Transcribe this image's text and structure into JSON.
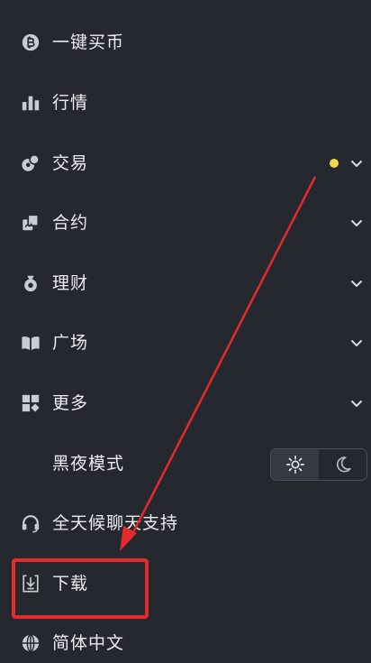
{
  "menu": {
    "buy_crypto": {
      "label": "一键买币",
      "icon": "bitcoin-icon"
    },
    "markets": {
      "label": "行情",
      "icon": "bar-chart-icon"
    },
    "trade": {
      "label": "交易",
      "icon": "trade-coins-icon",
      "has_notification": true,
      "notification_color": "#f0d84a"
    },
    "futures": {
      "label": "合约",
      "icon": "futures-icon"
    },
    "finance": {
      "label": "理财",
      "icon": "money-bag-icon"
    },
    "square": {
      "label": "广场",
      "icon": "book-icon"
    },
    "more": {
      "label": "更多",
      "icon": "grid-icon"
    },
    "dark_mode": {
      "label": "黑夜模式",
      "selected": "light",
      "options": [
        "sun-icon",
        "moon-icon"
      ]
    },
    "support": {
      "label": "全天候聊天支持",
      "icon": "headset-icon"
    },
    "download": {
      "label": "下载",
      "icon": "download-icon"
    },
    "language": {
      "label": "简体中文",
      "icon": "globe-icon"
    }
  },
  "annotation": {
    "color": "#e42a2a",
    "target": "download"
  },
  "colors": {
    "background": "#262830",
    "text": "#eceef2",
    "icon": "#c9ccd3"
  }
}
